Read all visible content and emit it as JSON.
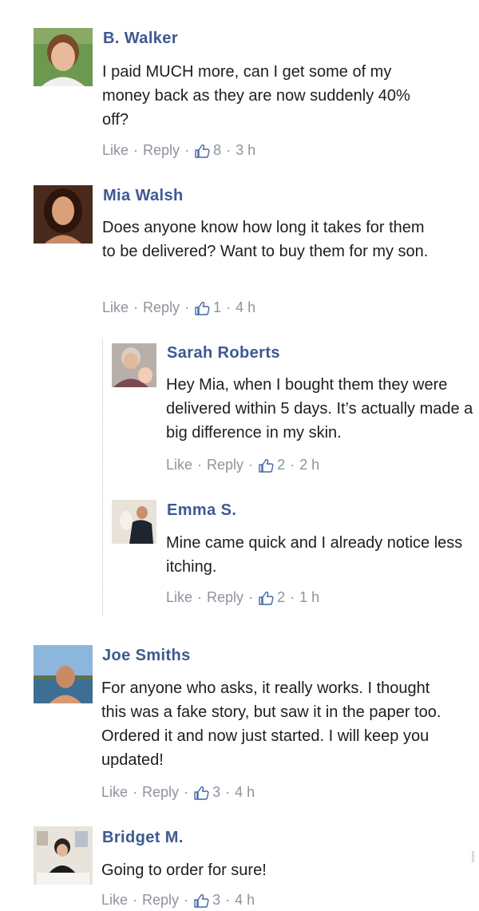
{
  "comments": [
    {
      "name": "B. Walker",
      "text": "I paid MUCH more, can I get some of my money back as they are now suddenly 40% off?",
      "like_label": "Like",
      "reply_label": "Reply",
      "likes": "8",
      "time": "3 h"
    },
    {
      "name": "Mia Walsh",
      "text": "Does anyone know how long it takes for them to be delivered? Want to buy them for my son.",
      "like_label": "Like",
      "reply_label": "Reply",
      "likes": "1",
      "time": "4 h",
      "replies": [
        {
          "name": "Sarah Roberts",
          "text": "Hey Mia, when I bought them they were delivered within 5 days. It’s actually made a big difference in my skin.",
          "like_label": "Like",
          "reply_label": "Reply",
          "likes": "2",
          "time": "2 h"
        },
        {
          "name": "Emma S.",
          "text": "Mine came quick and I already notice less itching.",
          "like_label": "Like",
          "reply_label": "Reply",
          "likes": "2",
          "time": "1 h"
        }
      ]
    },
    {
      "name": "Joe Smiths",
      "text": "For anyone who asks, it really works. I thought this was a fake story, but saw it in the paper too. Ordered it and now just started. I will keep you updated!",
      "like_label": "Like",
      "reply_label": "Reply",
      "likes": "3",
      "time": "4 h"
    },
    {
      "name": "Bridget M.",
      "text": "Going to order for sure!",
      "like_label": "Like",
      "reply_label": "Reply",
      "likes": "3",
      "time": "4 h"
    }
  ],
  "separator": "·",
  "colors": {
    "name": "#3b5998",
    "meta": "#8d949e",
    "text": "#1c1e21"
  },
  "icons": {
    "like": "thumbs-up-outline-icon"
  }
}
